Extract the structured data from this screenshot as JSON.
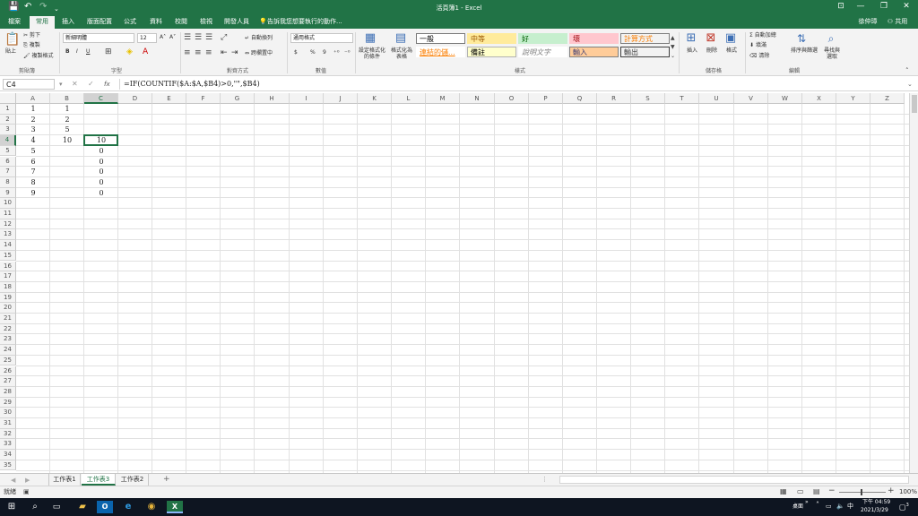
{
  "titlebar": {
    "title": "活頁簿1 - Excel",
    "save_glyph": "💾",
    "undo_glyph": "↶",
    "redo_glyph": "↷",
    "minimize": "—",
    "restore": "❐",
    "close": "✕",
    "ribbon_toggle": "⊡"
  },
  "ribbon_tabs": [
    "檔案",
    "常用",
    "插入",
    "版面配置",
    "公式",
    "資料",
    "校閱",
    "檢視",
    "開發人員"
  ],
  "active_tab": "常用",
  "tell_me": "告訴我您想要執行的動作...",
  "user": "徐仲璋",
  "share": "共用",
  "clipboard": {
    "paste": "貼上",
    "cut": "剪下",
    "copy": "複製",
    "format_painter": "複製格式",
    "label": "剪貼簿"
  },
  "font": {
    "name": "新細明體",
    "size": "12",
    "bold": "B",
    "italic": "I",
    "underline": "U",
    "grow": "A˄",
    "shrink": "A˅",
    "label": "字型"
  },
  "alignment": {
    "wrap": "自動換列",
    "merge": "跨欄置中",
    "label": "對齊方式"
  },
  "number": {
    "format": "通用格式",
    "currency": "$",
    "percent": "%",
    "comma": "9",
    "label": "數值"
  },
  "styles": {
    "conditional": "設定格式化的條件",
    "table": "格式化為表格",
    "cells": [
      {
        "text": "一般",
        "bg": "#ffffff",
        "fg": "#000000",
        "border": "#7a7a7a"
      },
      {
        "text": "中等",
        "bg": "#ffeb9c",
        "fg": "#9c5700",
        "border": "#ffeb9c"
      },
      {
        "text": "好",
        "bg": "#c6efce",
        "fg": "#006100",
        "border": "#c6efce"
      },
      {
        "text": "壞",
        "bg": "#ffc7ce",
        "fg": "#9c0006",
        "border": "#ffc7ce"
      },
      {
        "text": "計算方式",
        "bg": "#f2f2f2",
        "fg": "#fa7d00",
        "border": "#7f7f7f"
      },
      {
        "text": "連結的儲...",
        "bg": "#ffffff",
        "fg": "#fa7d00",
        "border": "#ffffff"
      },
      {
        "text": "備註",
        "bg": "#ffffcc",
        "fg": "#000000",
        "border": "#b2b2b2"
      },
      {
        "text": "說明文字",
        "bg": "#ffffff",
        "fg": "#7f7f7f",
        "border": "#ffffff"
      },
      {
        "text": "輸入",
        "bg": "#ffcc99",
        "fg": "#3f3f76",
        "border": "#7f7f7f"
      },
      {
        "text": "輸出",
        "bg": "#f2f2f2",
        "fg": "#3f3f3f",
        "border": "#3f3f3f"
      }
    ],
    "label": "樣式"
  },
  "cells_group": {
    "insert": "插入",
    "delete": "刪除",
    "format": "格式",
    "label": "儲存格"
  },
  "editing": {
    "autosum": "自動加總",
    "fill": "填滿",
    "clear": "清除",
    "sort": "排序與篩選",
    "find": "尋找與選取",
    "label": "編輯"
  },
  "formula_bar": {
    "name_box": "C4",
    "cancel": "✕",
    "enter": "✓",
    "fx": "fx",
    "formula": "=IF(COUNTIF($A:$A,$B4)>0,\"\",$B4)"
  },
  "columns": [
    "A",
    "B",
    "C",
    "D",
    "E",
    "F",
    "G",
    "H",
    "I",
    "J",
    "K",
    "L",
    "M",
    "N",
    "O",
    "P",
    "Q",
    "R",
    "S",
    "T",
    "U",
    "V",
    "W",
    "X",
    "Y",
    "Z"
  ],
  "rows": [
    "1",
    "2",
    "3",
    "4",
    "5",
    "6",
    "7",
    "8",
    "9",
    "10",
    "11",
    "12",
    "13",
    "14",
    "15",
    "16",
    "17",
    "18",
    "19",
    "20",
    "21",
    "22",
    "23",
    "24",
    "25",
    "26",
    "27",
    "28",
    "29",
    "30",
    "31",
    "32",
    "33",
    "34",
    "35"
  ],
  "grid": {
    "A": [
      "1",
      "2",
      "3",
      "4",
      "5",
      "6",
      "7",
      "8",
      "9"
    ],
    "B": [
      "1",
      "2",
      "5",
      "10"
    ],
    "C": [
      "",
      "",
      "",
      "10",
      "0",
      "0",
      "0",
      "0",
      "0"
    ]
  },
  "selected_cell": "C4",
  "sheet_tabs": [
    "工作表1",
    "工作表3",
    "工作表2"
  ],
  "active_sheet": "工作表3",
  "add_sheet": "+",
  "status": {
    "mode": "就緒",
    "zoom": "100%"
  },
  "taskbar": {
    "desktop": "桌面",
    "time": "下午 04:59",
    "date": "2021/3/29",
    "notifications": "3"
  }
}
